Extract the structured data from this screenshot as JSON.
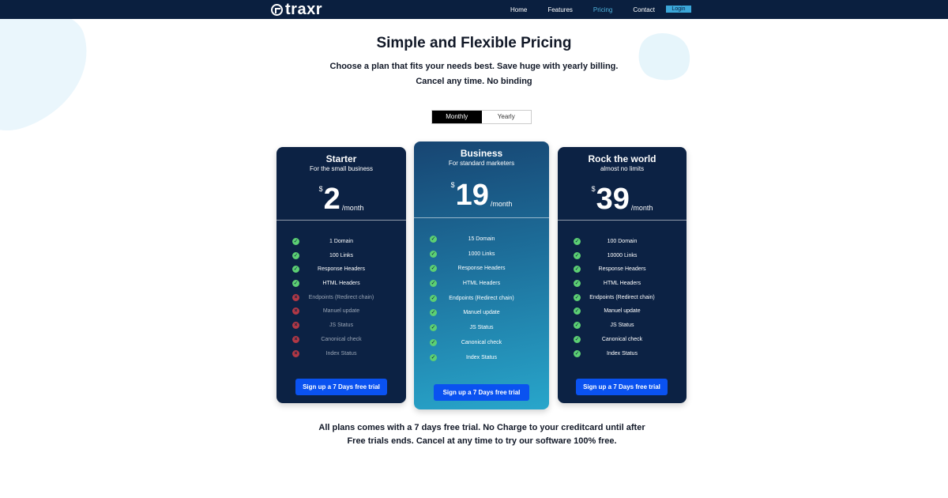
{
  "brand": {
    "name": "traxr"
  },
  "nav": {
    "items": [
      "Home",
      "Features",
      "Pricing",
      "Contact"
    ],
    "active": "Pricing",
    "login_label": "Login"
  },
  "hero": {
    "title": "Simple and Flexible Pricing",
    "subtitle_line1": "Choose a plan that fits your needs best. Save huge with yearly billing.",
    "subtitle_line2": "Cancel any time. No binding"
  },
  "billing_toggle": {
    "monthly_label": "Monthly",
    "yearly_label": "Yearly",
    "selected": "Monthly"
  },
  "plans": [
    {
      "name": "Starter",
      "tagline": "For the small business",
      "currency": "$",
      "price": "2",
      "period": "/month",
      "features": [
        {
          "label": "1 Domain",
          "included": true
        },
        {
          "label": "100 Links",
          "included": true
        },
        {
          "label": "Response Headers",
          "included": true
        },
        {
          "label": "HTML Headers",
          "included": true
        },
        {
          "label": "Endpoints (Redirect chain)",
          "included": false
        },
        {
          "label": "Manuel update",
          "included": false
        },
        {
          "label": "JS Status",
          "included": false
        },
        {
          "label": "Canonical check",
          "included": false
        },
        {
          "label": "Index Status",
          "included": false
        }
      ],
      "cta": "Sign up a 7 Days free trial"
    },
    {
      "name": "Business",
      "tagline": "For standard marketers",
      "currency": "$",
      "price": "19",
      "period": "/month",
      "features": [
        {
          "label": "15 Domain",
          "included": true
        },
        {
          "label": "1000 Links",
          "included": true
        },
        {
          "label": "Response Headers",
          "included": true
        },
        {
          "label": "HTML Headers",
          "included": true
        },
        {
          "label": "Endpoints (Redirect chain)",
          "included": true
        },
        {
          "label": "Manuel update",
          "included": true
        },
        {
          "label": "JS Status",
          "included": true
        },
        {
          "label": "Canonical check",
          "included": true
        },
        {
          "label": "Index Status",
          "included": true
        }
      ],
      "cta": "Sign up a 7 Days free trial"
    },
    {
      "name": "Rock the world",
      "tagline": "almost no limits",
      "currency": "$",
      "price": "39",
      "period": "/month",
      "features": [
        {
          "label": "100 Domain",
          "included": true
        },
        {
          "label": "10000 Links",
          "included": true
        },
        {
          "label": "Response Headers",
          "included": true
        },
        {
          "label": "HTML Headers",
          "included": true
        },
        {
          "label": "Endpoints (Redirect chain)",
          "included": true
        },
        {
          "label": "Manuel update",
          "included": true
        },
        {
          "label": "JS Status",
          "included": true
        },
        {
          "label": "Canonical check",
          "included": true
        },
        {
          "label": "Index Status",
          "included": true
        }
      ],
      "cta": "Sign up a 7 Days free trial"
    }
  ],
  "footer_note": {
    "line1": "All plans comes with a 7 days free trial. No Charge to your creditcard until after",
    "line2": "Free trials ends. Cancel at any time to try our software 100% free."
  },
  "colors": {
    "header_bg": "#0a1f3f",
    "card_bg": "#0c2244",
    "accent_link": "#4fb3dd",
    "cta_bg": "#0a52f0",
    "check_green": "#5ccf73",
    "cross_red": "#b23845"
  },
  "icons": {
    "included": "check-circle-icon",
    "excluded": "x-circle-icon",
    "logo": "traxr-logo-icon"
  }
}
